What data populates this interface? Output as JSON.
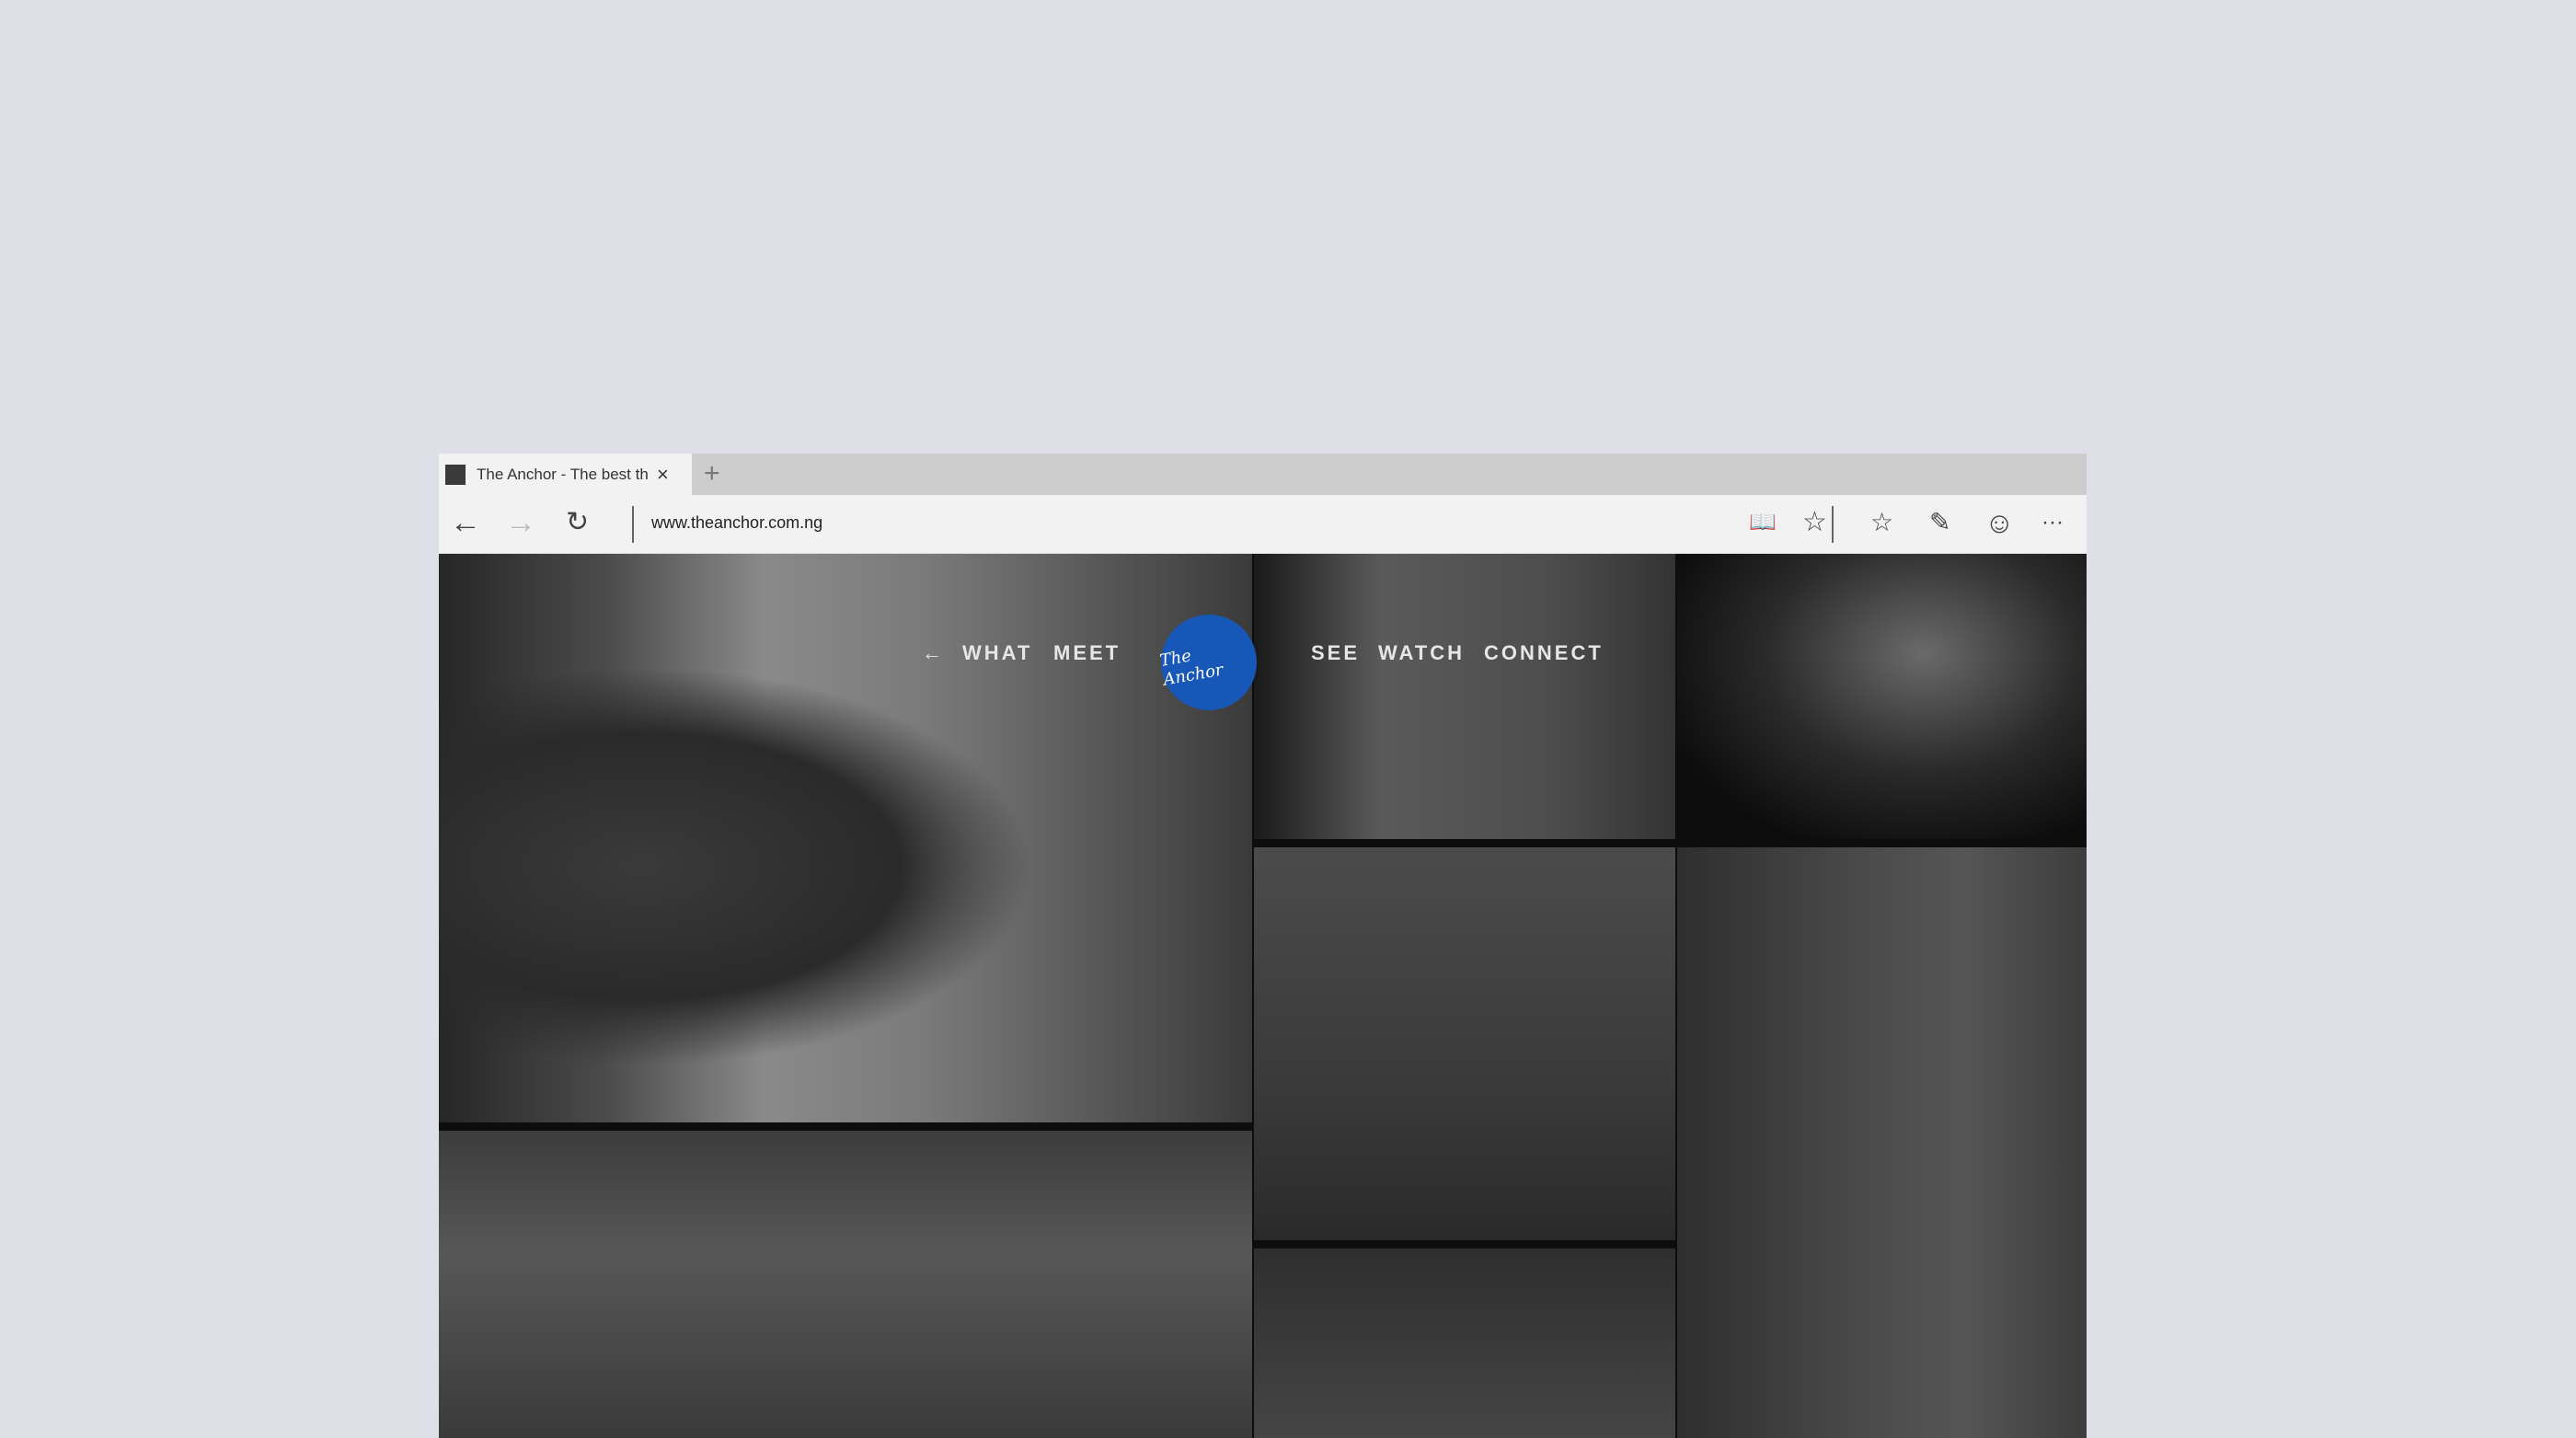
{
  "browser": {
    "tab_title": "The Anchor  - The best th",
    "close_icon": "×",
    "new_tab_icon": "+",
    "url": "www.theanchor.com.ng",
    "back_icon": "←",
    "forward_icon": "→",
    "refresh_icon": "↻",
    "reading_view_icon": "📖",
    "favorite_icon": "☆",
    "favorites_hub_icon": "☆",
    "web_note_icon": "✎",
    "feedback_icon": "☺",
    "more_icon": "···"
  },
  "site": {
    "nav": {
      "back_arrow": "←",
      "items": [
        "WHAT",
        "MEET",
        "SEE",
        "WATCH",
        "CONNECT"
      ]
    },
    "logo_text": "The Anchor",
    "logo_color": "#1657b8"
  }
}
